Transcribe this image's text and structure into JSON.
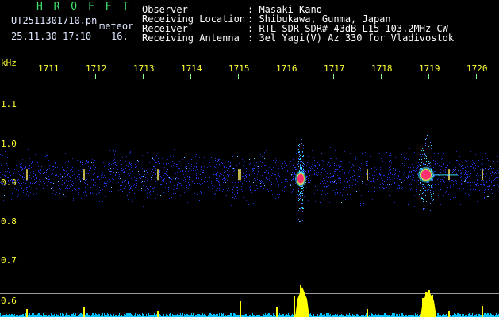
{
  "header": {
    "logo": "H R O F F T",
    "filename": "UT2511301710.pn",
    "meteor_label": "meteor",
    "datetime": "25.11.30 17:10",
    "count": "16.",
    "fields": [
      {
        "key": "Observer",
        "value": ": Masaki Kano"
      },
      {
        "key": "Receiving Location",
        "value": ": Shibukawa, Gunma, Japan"
      },
      {
        "key": "Receiver",
        "value": ": RTL-SDR SDR# 43dB L15 103.2MHz CW"
      },
      {
        "key": "Receiving Antenna",
        "value": ": 3el Yagi(V) Az 330 for Vladivostok"
      }
    ]
  },
  "axis": {
    "unit": "kHz",
    "x_ticks": [
      "1711",
      "1712",
      "1713",
      "1714",
      "1715",
      "1716",
      "1717",
      "1718",
      "1719",
      "1720"
    ],
    "y_ticks": [
      "1.1",
      "1.0",
      "0.9",
      "0.8",
      "0.7",
      "0.6"
    ]
  },
  "colors": {
    "background": "#000000",
    "noise": "#1a2fd6",
    "echo_core": "#ff3070",
    "echo_halo": "#3fe0ff",
    "echo_mid": "#e8f040",
    "bars": "#ffff00",
    "baseline": "#00c0ff"
  },
  "spectrum": {
    "noise_band_low": 0.83,
    "noise_band_high": 1.0,
    "echoes": [
      {
        "at_khz": 1716.0,
        "freq_khz": 0.91,
        "strength": 1.0
      },
      {
        "at_khz": 1719.0,
        "freq_khz": 0.92,
        "strength": 0.9
      }
    ]
  }
}
